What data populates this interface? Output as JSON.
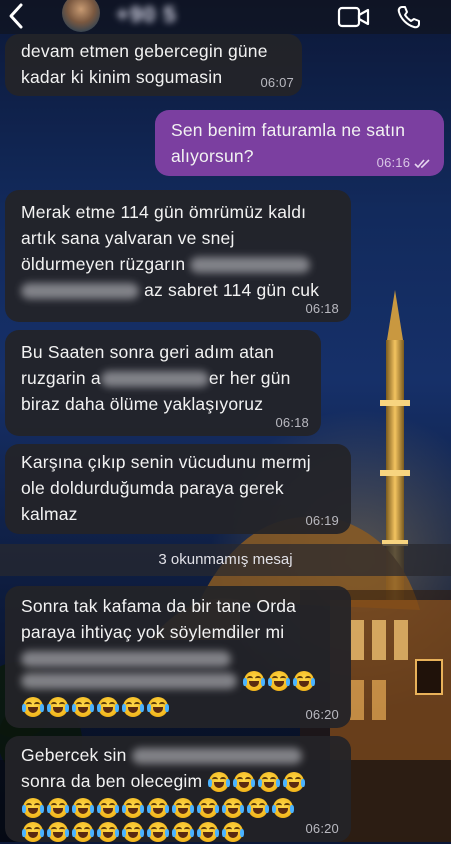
{
  "header": {
    "contact_number": "+90 5",
    "icons": [
      "back-chevron-icon",
      "avatar",
      "video-call-icon",
      "phone-call-icon"
    ]
  },
  "messages": [
    {
      "dir": "in",
      "lines": [
        "devam etmen gebercegin güne",
        "kadar ki kinim sogumasin"
      ],
      "time": "06:07"
    },
    {
      "dir": "out",
      "lines": [
        "Sen benim faturamla ne satın",
        "alıyorsun?"
      ],
      "time": "06:16",
      "read": true
    },
    {
      "dir": "in",
      "lines": [
        "Merak etme 114 gün ömrümüz kaldı",
        "artık sana yalvaran ve snej",
        "öldurmeyen rüzgarın",
        "az sabret 114 gün cuk"
      ],
      "time": "06:18"
    },
    {
      "dir": "in",
      "lines": [
        "Bu Saaten sonra geri adım atan",
        "ruzgarin a",
        "er her gün",
        "biraz daha ölüme yaklaşıyoruz"
      ],
      "time": "06:18"
    },
    {
      "dir": "in",
      "lines": [
        "Karşına çıkıp senin vücudunu mermj",
        "ole doldurduğumda paraya gerek",
        "kalmaz"
      ],
      "time": "06:19"
    },
    {
      "dir": "in",
      "lines": [
        "Sonra tak kafama da bir tane Orda",
        "paraya ihtiyaç yok söylemdiler mi"
      ],
      "time": "06:20"
    },
    {
      "dir": "in",
      "lines": [
        "Gebercek sin",
        "sonra da ben olecegim"
      ],
      "time": "06:20"
    }
  ],
  "unread_label": "3 okunmamış mesaj",
  "colors": {
    "outgoing": "#7b3fa0",
    "incoming": "#242428",
    "emoji": "#f3b81e"
  }
}
